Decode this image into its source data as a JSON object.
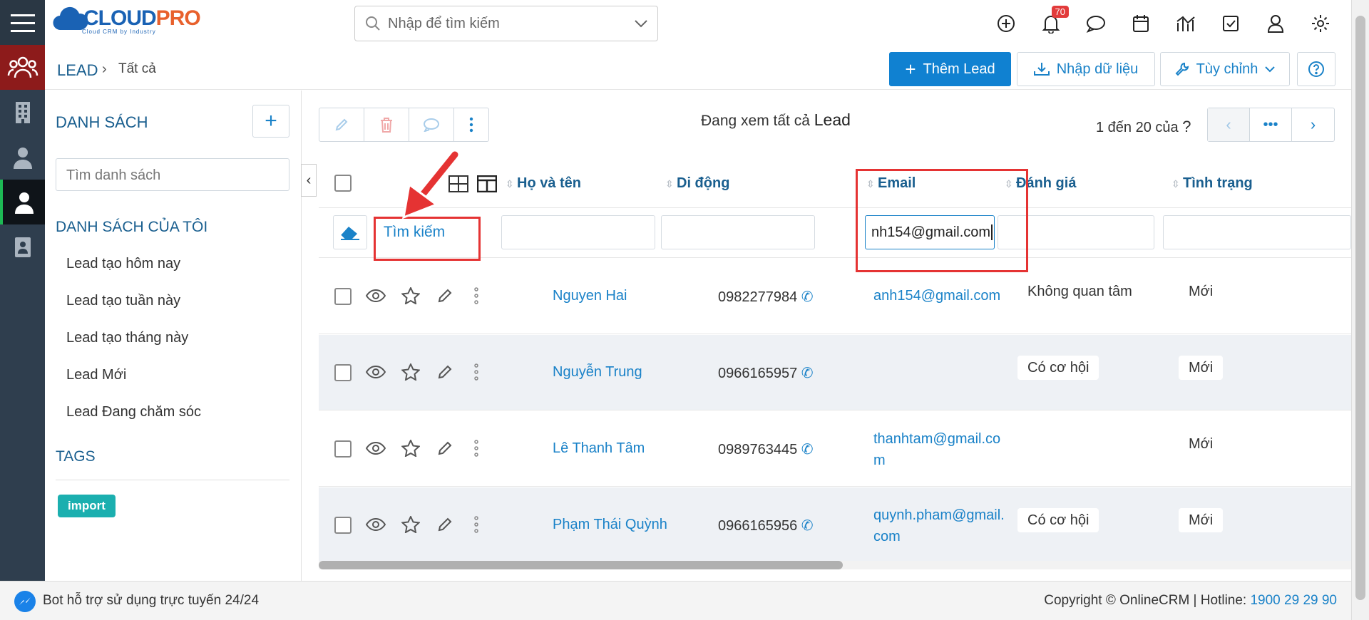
{
  "app": {
    "logo_main": "CLOUD",
    "logo_accent": "PRO",
    "logo_sub": "Cloud CRM by Industry"
  },
  "search": {
    "placeholder": "Nhập để tìm kiếm"
  },
  "notifications": {
    "count": "70"
  },
  "breadcrumb": {
    "module": "LEAD",
    "current": "Tất cả"
  },
  "actions": {
    "add_lead": "Thêm Lead",
    "import": "Nhập dữ liệu",
    "customize": "Tùy chỉnh"
  },
  "sidebar": {
    "lists_title": "DANH SÁCH",
    "search_placeholder": "Tìm danh sách",
    "my_lists_title": "DANH SÁCH CỦA TÔI",
    "items": [
      "Lead tạo hôm nay",
      "Lead tạo tuần này",
      "Lead tạo tháng này",
      "Lead Mới",
      "Lead Đang chăm sóc"
    ],
    "tags_title": "TAGS",
    "tag": "import"
  },
  "view": {
    "viewing_prefix": "Đang xem tất cả",
    "viewing_module": "Lead",
    "pager_text": "1 đến 20 của",
    "pager_help": "?"
  },
  "table": {
    "columns": [
      "Họ và tên",
      "Di động",
      "Email",
      "Đánh giá",
      "Tình trạng"
    ],
    "search_label": "Tìm kiếm",
    "email_filter_value": "nh154@gmail.com",
    "rows": [
      {
        "name": "Nguyen Hai",
        "phone": "0982277984",
        "email_l1": "anh154@gmail.com",
        "email_l2": "",
        "rating": "Không quan tâm",
        "status": "Mới"
      },
      {
        "name": "Nguyễn Trung",
        "phone": "0966165957",
        "email_l1": "",
        "email_l2": "",
        "rating": "Có cơ hội",
        "status": "Mới"
      },
      {
        "name": "Lê Thanh Tâm",
        "phone": "0989763445",
        "email_l1": "thanhtam@gmail.co",
        "email_l2": "m",
        "rating": "",
        "status": "Mới"
      },
      {
        "name": "Phạm Thái Quỳnh",
        "phone": "0966165956",
        "email_l1": "quynh.pham@gmail.",
        "email_l2": "com",
        "rating": "Có cơ hội",
        "status": "Mới"
      }
    ]
  },
  "footer": {
    "bot_text": "Bot hỗ trợ sử dụng trực tuyến 24/24",
    "copyright": "Copyright © OnlineCRM | Hotline: ",
    "hotline": "1900 29 29 90"
  },
  "colors": {
    "primary": "#1081d1",
    "link": "#1a82c8",
    "rail": "#2f3e4e",
    "annotation": "#e53333",
    "tag": "#1bafaf"
  }
}
